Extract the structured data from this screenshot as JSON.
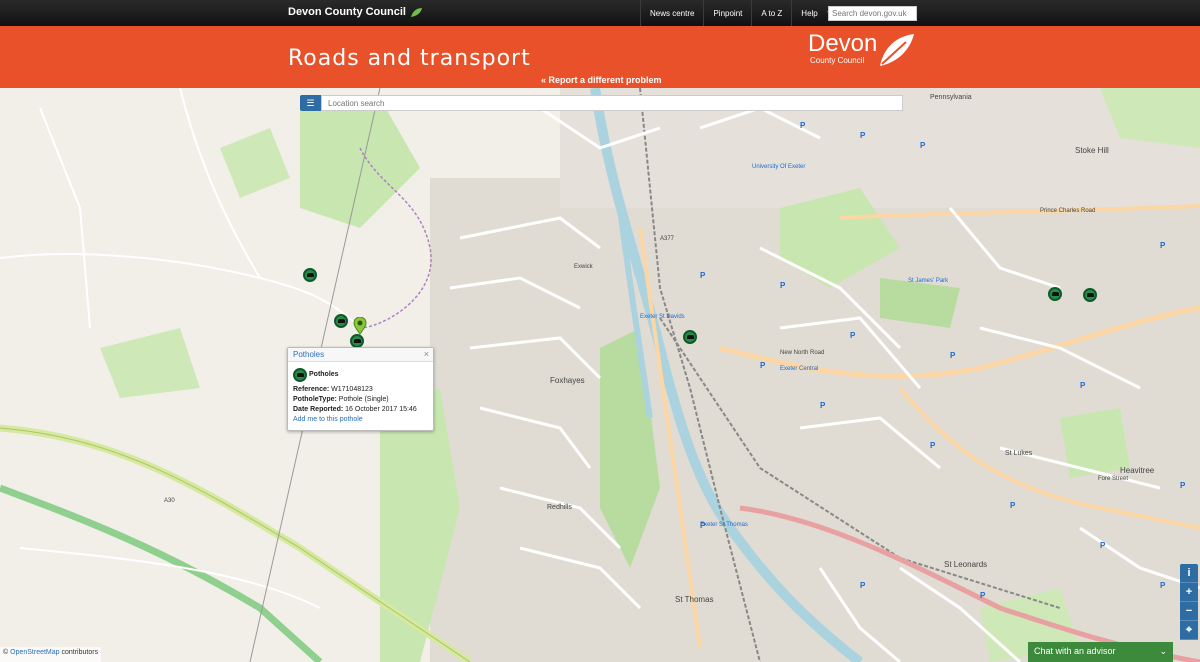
{
  "topbar": {
    "brand": "Devon County Council",
    "nav": [
      {
        "label": "News centre"
      },
      {
        "label": "Pinpoint"
      },
      {
        "label": "A to Z"
      },
      {
        "label": "Help"
      }
    ],
    "search_placeholder": "Search devon.gov.uk"
  },
  "header": {
    "title": "Roads and transport",
    "report_link": "« Report a different problem",
    "logo_main": "Devon",
    "logo_sub": "County Council"
  },
  "map": {
    "location_search_placeholder": "Location search",
    "labels": {
      "exwick": "Exwick",
      "foxhayes": "Foxhayes",
      "redhills": "Redhills",
      "st_thomas": "St Thomas",
      "exeter_st_davids": "Exeter St Davids",
      "exeter_central": "Exeter Central",
      "st_james_park": "St James' Park",
      "st_leonards": "St Leonards",
      "heavitree": "Heavitree",
      "st_lukes": "St Lukes",
      "university": "University Of Exeter",
      "stoke_hill": "Stoke Hill",
      "pennsylvania": "Pennsylvania",
      "exeter_st_thomas": "Exeter St Thomas",
      "new_north_road": "New North Road",
      "prince_charles_road": "Prince Charles Road",
      "a377": "A377",
      "a30": "A30",
      "fore_street": "Fore Street"
    },
    "popup": {
      "header": "Potholes",
      "close": "×",
      "title": "Potholes",
      "reference_label": "Reference:",
      "reference_value": "W171048123",
      "type_label": "PotholeType:",
      "type_value": "Pothole (Single)",
      "date_label": "Date Reported:",
      "date_value": "16 October 2017 15:46",
      "link": "Add me to this pothole"
    },
    "zoom": {
      "info": "i",
      "plus": "+",
      "minus": "−",
      "locate": "⌖"
    },
    "attribution_prefix": "©",
    "attribution_link": "OpenStreetMap",
    "attribution_suffix": "contributors"
  },
  "chat": {
    "label": "Chat with an advisor",
    "chevron": "⌄"
  },
  "colors": {
    "header": "#e8512a",
    "marker": "#2a8a4a",
    "accent_blue": "#2e6da4",
    "chat": "#3d8a3d"
  }
}
